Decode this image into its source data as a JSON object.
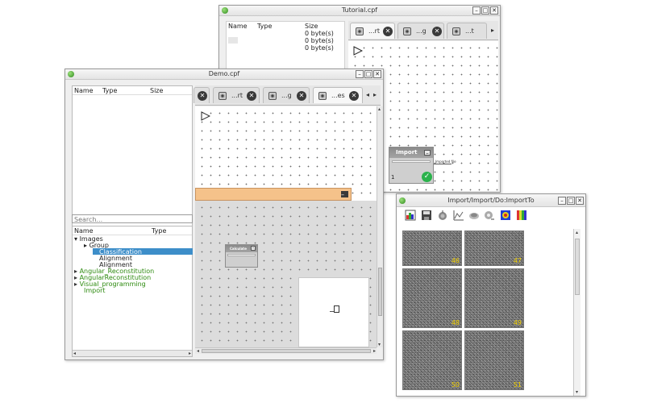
{
  "tutorial_window": {
    "title": "Tutorial.cpf",
    "headers": {
      "name": "Name",
      "type": "Type",
      "size": "Size"
    },
    "sizes": [
      "0 byte(s)",
      "0 byte(s)",
      "0 byte(s)"
    ],
    "tabs": [
      {
        "label": "...rt"
      },
      {
        "label": "...g"
      },
      {
        "label": "...t"
      }
    ],
    "node": {
      "title": "Import",
      "output_label": "Imported file",
      "port": "1"
    }
  },
  "demo_window": {
    "title": "Demo.cpf",
    "headers": {
      "name": "Name",
      "type": "Type",
      "size": "Size"
    },
    "search_placeholder": "Search...",
    "tree_headers": {
      "name": "Name",
      "type": "Type"
    },
    "tree": [
      {
        "label": "Images",
        "expander": "▾"
      },
      {
        "label": "Group",
        "expander": "▸"
      },
      {
        "label": "Classification"
      },
      {
        "label": "Alignment"
      },
      {
        "label": "Alignment"
      },
      {
        "label": "Angular_Reconstitution",
        "expander": "▸"
      },
      {
        "label": "AngularReconstitution",
        "expander": "▸"
      },
      {
        "label": "Visual_programming",
        "expander": "▸"
      },
      {
        "label": "Import"
      }
    ],
    "tabs": [
      {
        "label": "...rt"
      },
      {
        "label": "...g"
      },
      {
        "label": "...es"
      }
    ],
    "node": {
      "title": "Calculate"
    }
  },
  "viewer_window": {
    "title": "Import/Import/Do:ImportTo",
    "image_numbers": [
      "46",
      "47",
      "48",
      "49",
      "50",
      "51"
    ]
  },
  "colors": {
    "accent_selection": "#3d8ec9",
    "tree_green": "#2e8b10",
    "orange_band": "#f5c28a",
    "success_green": "#2bb24c"
  }
}
